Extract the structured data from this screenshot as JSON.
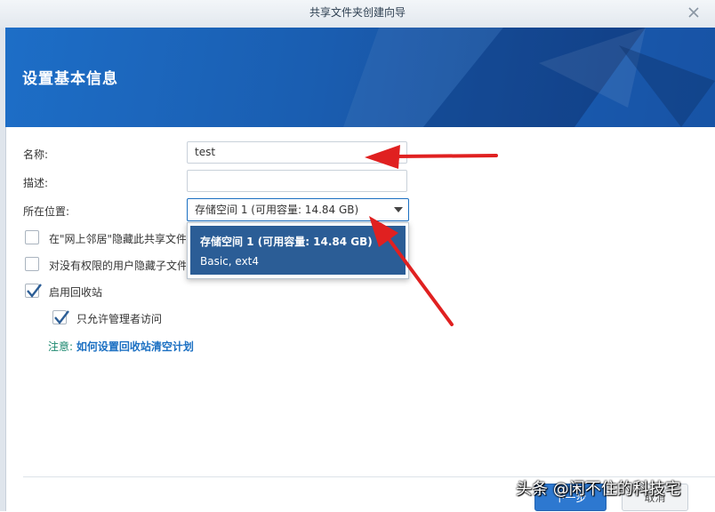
{
  "window": {
    "title": "共享文件夹创建向导"
  },
  "header": {
    "title": "设置基本信息"
  },
  "form": {
    "name_label": "名称:",
    "name_value": "test",
    "description_label": "描述:",
    "description_value": "",
    "location_label": "所在位置:",
    "location_value": "存储空间 1 (可用容量:  14.84 GB)"
  },
  "dropdown": {
    "options": [
      {
        "title": "存储空间 1 (可用容量:  14.84 GB)",
        "subtitle": "Basic, ext4"
      }
    ]
  },
  "options": {
    "hide_network": {
      "label": "在\"网上邻居\"隐藏此共享文件",
      "checked": false
    },
    "hide_subfolders": {
      "label": "对没有权限的用户隐藏子文件",
      "checked": false
    },
    "recycle_bin": {
      "label": "启用回收站",
      "checked": true
    },
    "admin_only": {
      "label": "只允许管理者访问",
      "checked": true
    }
  },
  "note": {
    "prefix": "注意:",
    "link": "如何设置回收站清空计划"
  },
  "footer": {
    "next_label": "下一步",
    "cancel_label": "取消"
  },
  "watermark": {
    "text": "头条 @闲不住的科技宅"
  },
  "colors": {
    "accent": "#2d78d0",
    "header_bg": "#1a5db0",
    "selected": "#2b5d96",
    "annotation_arrow": "#e02020"
  }
}
